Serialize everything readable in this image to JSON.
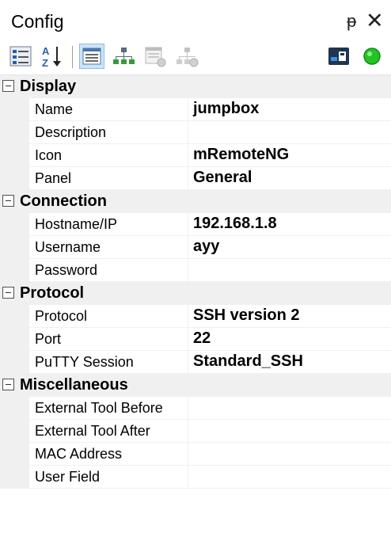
{
  "window": {
    "title": "Config"
  },
  "title_buttons": {
    "pin": "ᵽ",
    "close": "✕"
  },
  "toolbar": {
    "icons": [
      "categorized-icon",
      "alphabetical-icon",
      "properties-icon",
      "inheritance-icon",
      "default-properties-icon",
      "default-inheritance-icon",
      "host-status-icon",
      "status-online-icon"
    ],
    "status_color": "#25c425"
  },
  "sections": [
    {
      "name": "Display",
      "rows": [
        {
          "label": "Name",
          "value": "jumpbox"
        },
        {
          "label": "Description",
          "value": ""
        },
        {
          "label": "Icon",
          "value": "mRemoteNG"
        },
        {
          "label": "Panel",
          "value": "General"
        }
      ]
    },
    {
      "name": "Connection",
      "rows": [
        {
          "label": "Hostname/IP",
          "value": "192.168.1.8"
        },
        {
          "label": "Username",
          "value": "ayy"
        },
        {
          "label": "Password",
          "value": ""
        }
      ]
    },
    {
      "name": "Protocol",
      "rows": [
        {
          "label": "Protocol",
          "value": "SSH version 2"
        },
        {
          "label": "Port",
          "value": "22"
        },
        {
          "label": "PuTTY Session",
          "value": "Standard_SSH"
        }
      ]
    },
    {
      "name": "Miscellaneous",
      "rows": [
        {
          "label": "External Tool Before",
          "value": ""
        },
        {
          "label": "External Tool After",
          "value": ""
        },
        {
          "label": "MAC Address",
          "value": ""
        },
        {
          "label": "User Field",
          "value": ""
        }
      ]
    }
  ]
}
